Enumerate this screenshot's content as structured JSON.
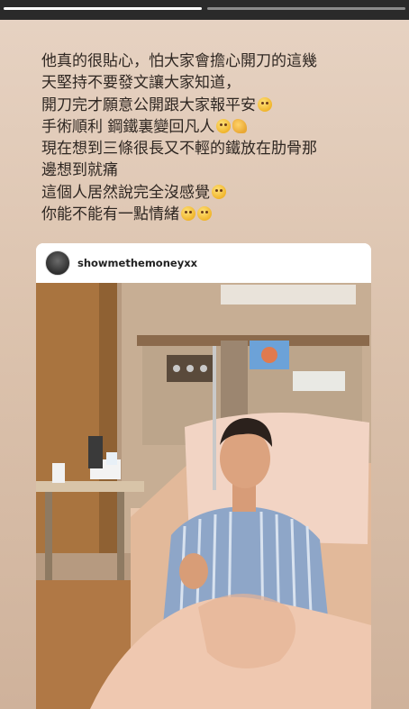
{
  "story": {
    "progress_segments": 2,
    "active_segment": 1
  },
  "caption": {
    "lines": [
      "他真的很貼心，怕大家會擔心開刀的這幾",
      "天堅持不要發文讓大家知道，",
      "開刀完才願意公開跟大家報平安",
      "手術順利 鋼鐵裏變回凡人",
      "現在想到三條很長又不輕的鐵放在肋骨那",
      "邊想到就痛",
      "這個人居然說完全沒感覺",
      "你能不能有一點情緒"
    ]
  },
  "post": {
    "username": "showmethemoneyxx",
    "emoji_icons": [
      "worried-face-icon",
      "sweat-smile-icon",
      "flexed-biceps-icon",
      "grinning-face-icon",
      "smirk-face-icon",
      "grinning-face-icon"
    ]
  },
  "colors": {
    "background": "#dcc3ae",
    "text": "#2f2722",
    "top_bar": "#2a2a2a"
  }
}
